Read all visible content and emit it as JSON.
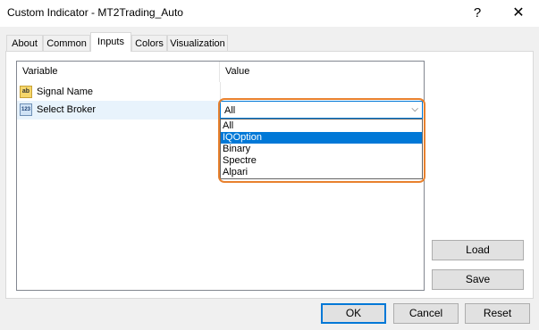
{
  "window": {
    "title": "Custom Indicator - MT2Trading_Auto",
    "help_glyph": "?",
    "close_glyph": "✕"
  },
  "tabs": [
    {
      "label": "About",
      "active": false
    },
    {
      "label": "Common",
      "active": false
    },
    {
      "label": "Inputs",
      "active": true
    },
    {
      "label": "Colors",
      "active": false
    },
    {
      "label": "Visualization",
      "active": false
    }
  ],
  "grid": {
    "headers": {
      "variable": "Variable",
      "value": "Value"
    },
    "rows": [
      {
        "icon": "string-type-icon",
        "icon_text": "ab",
        "name": "Signal Name",
        "value": ""
      },
      {
        "icon": "enum-type-icon",
        "icon_text": "123",
        "name": "Select Broker",
        "value": "All"
      }
    ]
  },
  "broker_select": {
    "current": "All",
    "arrow": "⌵",
    "options": [
      "All",
      "IQOption",
      "Binary",
      "Spectre",
      "Alpari"
    ],
    "highlighted": "IQOption"
  },
  "side_buttons": {
    "load": "Load",
    "save": "Save"
  },
  "footer_buttons": {
    "ok": "OK",
    "cancel": "Cancel",
    "reset": "Reset"
  },
  "colors": {
    "accent": "#0078d7",
    "annotation_ring": "#e8812e",
    "selected_row": "#e8f3fc"
  }
}
